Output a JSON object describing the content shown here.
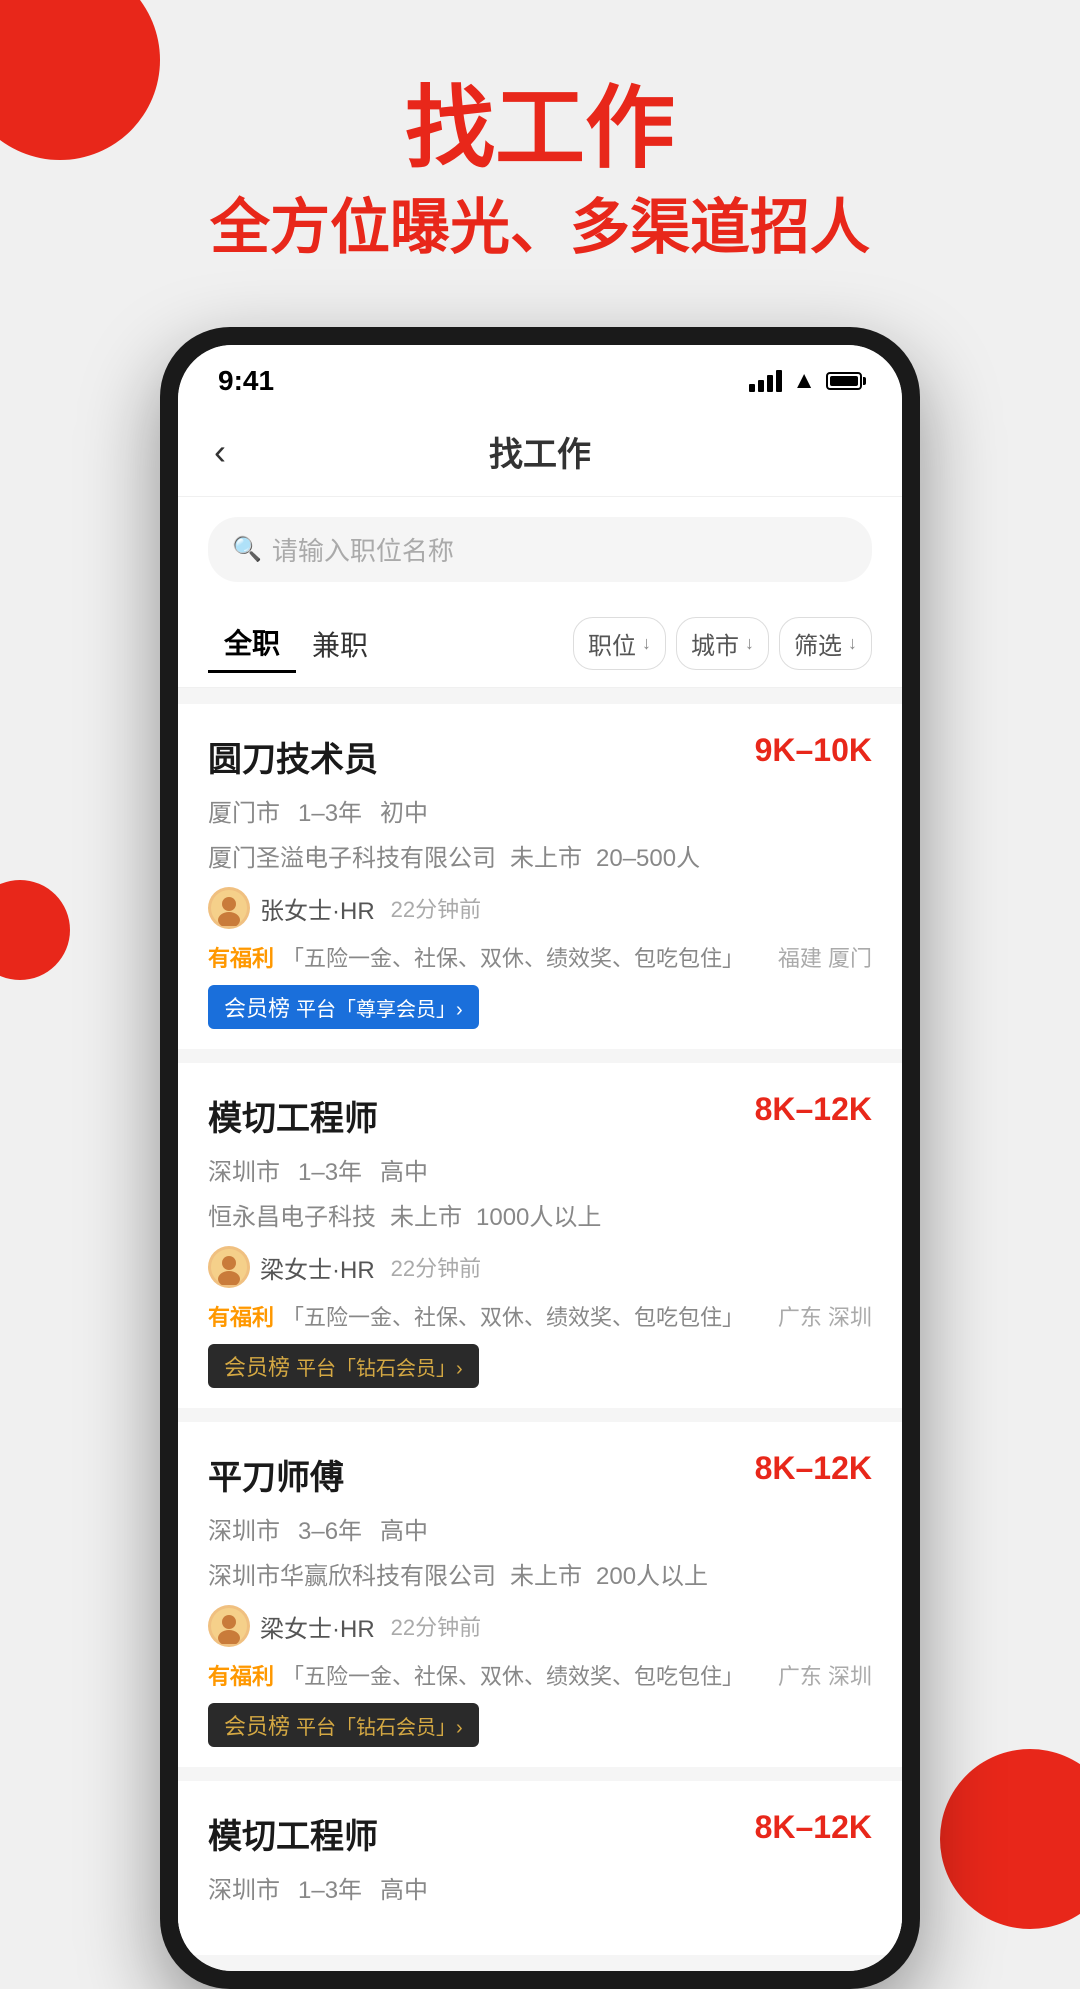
{
  "page": {
    "bg_title": "找工作",
    "bg_subtitle": "全方位曝光、多渠道招人",
    "status_time": "9:41",
    "nav_back": "‹",
    "nav_title": "找工作",
    "search_placeholder": "请输入职位名称",
    "filter_tabs": [
      {
        "label": "全职",
        "active": true
      },
      {
        "label": "兼职",
        "active": false
      }
    ],
    "filter_buttons": [
      {
        "label": "职位",
        "suffix": "↓"
      },
      {
        "label": "城市",
        "suffix": "↓"
      },
      {
        "label": "筛选",
        "suffix": "↓"
      }
    ],
    "jobs": [
      {
        "title": "圆刀技术员",
        "salary": "9K–10K",
        "city": "厦门市",
        "experience": "1–3年",
        "education": "初中",
        "company": "厦门圣溢电子科技有限公司",
        "company_stage": "未上市",
        "company_size": "20–500人",
        "hr_name": "张女士·HR",
        "hr_time": "22分钟前",
        "benefit_label": "有福利",
        "benefits": "「五险一金、社保、双休、绩效奖、包吃包住」",
        "location": "福建 厦门",
        "badge_type": "blue",
        "badge_text": "平台「尊享会员」›"
      },
      {
        "title": "模切工程师",
        "salary": "8K–12K",
        "city": "深圳市",
        "experience": "1–3年",
        "education": "高中",
        "company": "恒永昌电子科技",
        "company_stage": "未上市",
        "company_size": "1000人以上",
        "hr_name": "梁女士·HR",
        "hr_time": "22分钟前",
        "benefit_label": "有福利",
        "benefits": "「五险一金、社保、双休、绩效奖、包吃包住」",
        "location": "广东 深圳",
        "badge_type": "dark",
        "badge_text": "平台「钻石会员」›"
      },
      {
        "title": "平刀师傅",
        "salary": "8K–12K",
        "city": "深圳市",
        "experience": "3–6年",
        "education": "高中",
        "company": "深圳市华赢欣科技有限公司",
        "company_stage": "未上市",
        "company_size": "200人以上",
        "hr_name": "梁女士·HR",
        "hr_time": "22分钟前",
        "benefit_label": "有福利",
        "benefits": "「五险一金、社保、双休、绩效奖、包吃包住」",
        "location": "广东 深圳",
        "badge_type": "dark",
        "badge_text": "平台「钻石会员」›"
      },
      {
        "title": "模切工程师",
        "salary": "8K–12K",
        "city": "深圳市",
        "experience": "1–3年",
        "education": "高中",
        "company": "",
        "company_stage": "",
        "company_size": "",
        "hr_name": "",
        "hr_time": "",
        "benefit_label": "",
        "benefits": "",
        "location": "",
        "badge_type": "",
        "badge_text": ""
      }
    ],
    "badge_label": "会员榜"
  }
}
